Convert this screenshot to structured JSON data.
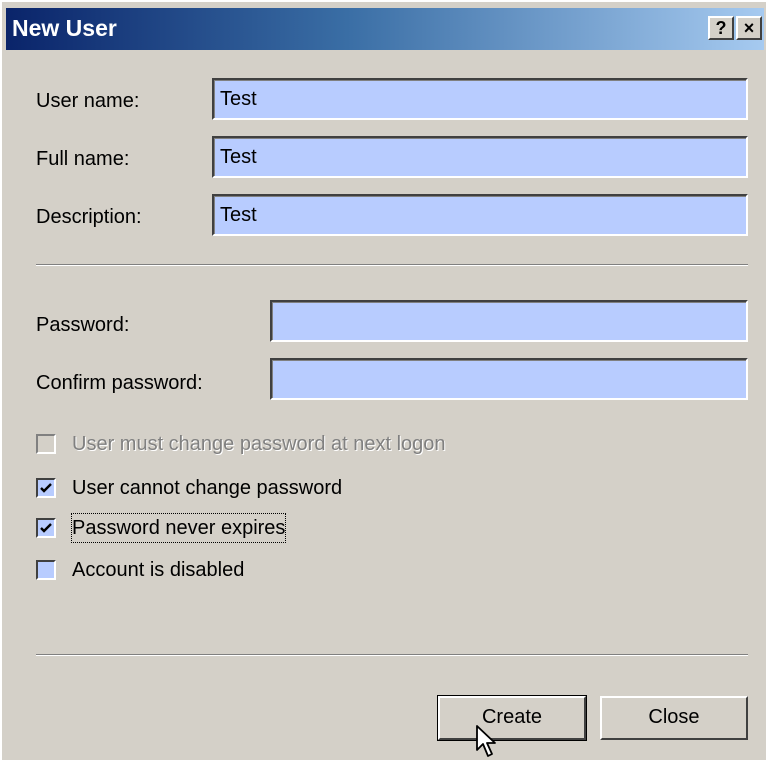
{
  "window": {
    "title": "New User",
    "help_button": "?",
    "close_button": "×"
  },
  "fields": {
    "user_name": {
      "label": "User name:",
      "value": "Test"
    },
    "full_name": {
      "label": "Full name:",
      "value": "Test"
    },
    "description": {
      "label": "Description:",
      "value": "Test"
    },
    "password": {
      "label": "Password:",
      "value": ""
    },
    "confirm_password": {
      "label": "Confirm password:",
      "value": ""
    }
  },
  "options": [
    {
      "label": "User must change password at next logon",
      "checked": false,
      "enabled": false
    },
    {
      "label": "User cannot change password",
      "checked": true,
      "enabled": true
    },
    {
      "label": "Password never expires",
      "checked": true,
      "enabled": true
    },
    {
      "label": "Account is disabled",
      "checked": false,
      "enabled": true
    }
  ],
  "buttons": {
    "create": "Create",
    "close": "Close"
  },
  "colors": {
    "dialog_bg": "#d4d0c8",
    "field_bg": "#b8ccff",
    "title_gradient_start": "#0a246a",
    "title_gradient_end": "#a6caf0"
  }
}
